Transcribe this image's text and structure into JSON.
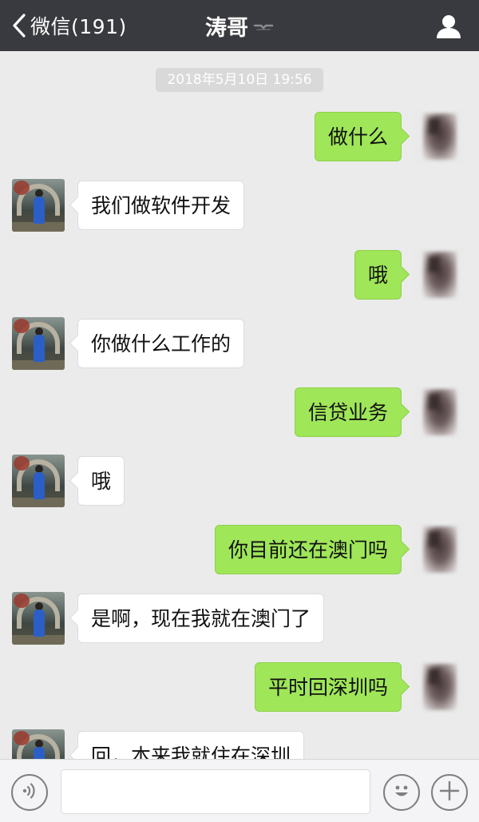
{
  "header": {
    "back_label": "微信(191)",
    "title": "涛哥",
    "icons": [
      "chevron-left-icon",
      "mute-icon",
      "person-icon"
    ]
  },
  "chat": {
    "timestamp": "2018年5月10日 19:56",
    "messages": [
      {
        "from": "self",
        "text": "做什么"
      },
      {
        "from": "friend",
        "text": "我们做软件开发"
      },
      {
        "from": "self",
        "text": "哦"
      },
      {
        "from": "friend",
        "text": "你做什么工作的"
      },
      {
        "from": "self",
        "text": "信贷业务"
      },
      {
        "from": "friend",
        "text": "哦"
      },
      {
        "from": "self",
        "text": "你目前还在澳门吗"
      },
      {
        "from": "friend",
        "text": "是啊，现在我就在澳门了"
      },
      {
        "from": "self",
        "text": "平时回深圳吗"
      },
      {
        "from": "friend",
        "text": "回，本来我就住在深圳"
      }
    ]
  },
  "input_bar": {
    "value": "",
    "icons": [
      "voice-icon",
      "emoji-icon",
      "plus-icon"
    ]
  },
  "colors": {
    "header_bg": "#393a3f",
    "chat_bg": "#ebebeb",
    "self_bubble": "#9fe658",
    "friend_bubble": "#ffffff",
    "timestamp_bg": "#d9d9d9"
  }
}
